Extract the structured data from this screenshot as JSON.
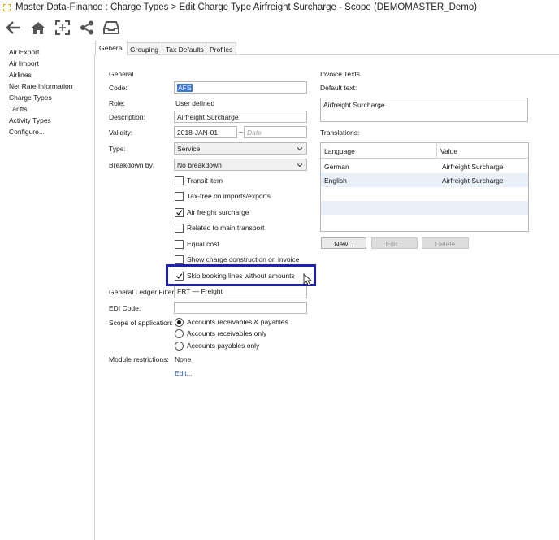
{
  "window": {
    "title": "Master Data-Finance : Charge Types > Edit Charge Type Airfreight Surcharge - Scope (DEMOMASTER_Demo)"
  },
  "toolbar": {
    "icons": [
      "back-arrow-icon",
      "home-icon",
      "expand-icon",
      "share-icon",
      "inbox-icon"
    ]
  },
  "sidebar": {
    "items": [
      {
        "label": "Air Export"
      },
      {
        "label": "Air Import"
      },
      {
        "label": "Airlines"
      },
      {
        "label": "Net Rate Information"
      },
      {
        "label": "Charge Types"
      },
      {
        "label": "Tariffs"
      },
      {
        "label": "Activity Types"
      },
      {
        "label": "Configure..."
      }
    ]
  },
  "tabs": [
    {
      "label": "General",
      "active": true
    },
    {
      "label": "Grouping",
      "active": false
    },
    {
      "label": "Tax Defaults",
      "active": false
    },
    {
      "label": "Profiles",
      "active": false
    }
  ],
  "general": {
    "section_title": "General",
    "code_label": "Code:",
    "code_value": "AFS",
    "role_label": "Role:",
    "role_value": "User defined",
    "description_label": "Description:",
    "description_value": "Airfreight Surcharge",
    "validity_label": "Validity:",
    "validity_from": "2018-JAN-01",
    "validity_sep": "–",
    "validity_to_placeholder": "Date",
    "type_label": "Type:",
    "type_value": "Service",
    "breakdown_label": "Breakdown by:",
    "breakdown_value": "No breakdown",
    "checkboxes": [
      {
        "label": "Transit item",
        "checked": false
      },
      {
        "label": "Tax-free on imports/exports",
        "checked": false
      },
      {
        "label": "Air freight surcharge",
        "checked": true
      },
      {
        "label": "Related to main transport",
        "checked": false
      },
      {
        "label": "Equal cost",
        "checked": false
      },
      {
        "label": "Show charge construction on invoice",
        "checked": false
      },
      {
        "label": "Skip booking lines without amounts",
        "checked": true
      }
    ],
    "gl_filter_label": "General Ledger Filter:",
    "gl_filter_value": "FRT — Freight",
    "edi_code_label": "EDI Code:",
    "edi_code_value": "",
    "scope_label": "Scope of application:",
    "scope_options": [
      {
        "label": "Accounts receivables & payables",
        "selected": true
      },
      {
        "label": "Accounts receivables only",
        "selected": false
      },
      {
        "label": "Accounts payables only",
        "selected": false
      }
    ],
    "module_label": "Module restrictions:",
    "module_value": "None",
    "module_edit": "Edit..."
  },
  "invoice_texts": {
    "section_title": "Invoice Texts",
    "default_label": "Default text:",
    "default_value": "Airfreight Surcharge",
    "translations_label": "Translations:",
    "columns": [
      "Language",
      "Value"
    ],
    "rows": [
      {
        "language": "German",
        "value": "Airfreight Surcharge"
      },
      {
        "language": "English",
        "value": "Airfreight Surcharge"
      }
    ],
    "buttons": {
      "new": "New...",
      "edit": "Edit...",
      "delete": "Delete"
    }
  },
  "colors": {
    "highlight": "#1f1fb4",
    "selection": "#3a78d6",
    "link": "#2a5db0"
  }
}
